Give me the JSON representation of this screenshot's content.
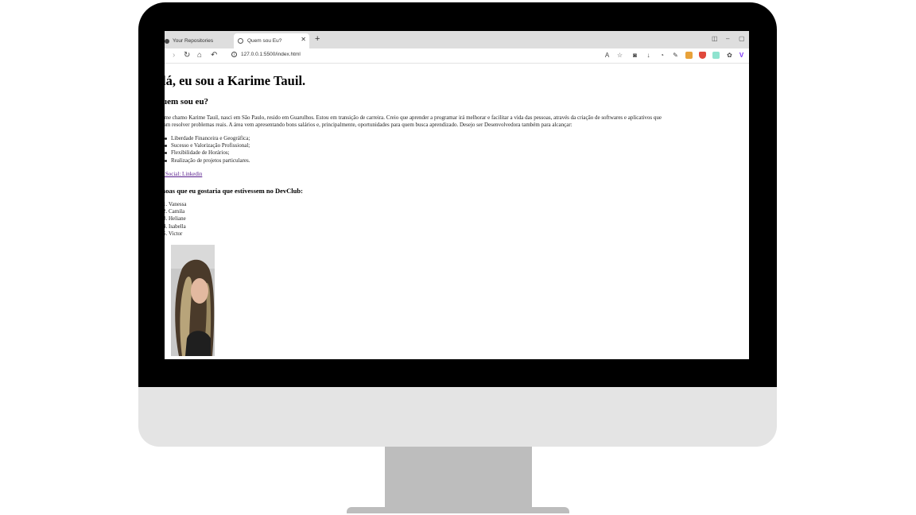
{
  "browser": {
    "tabs": [
      {
        "label": "Your Repositories",
        "active": false
      },
      {
        "label": "Quem sou Eu?",
        "active": true
      }
    ],
    "new_tab_icon": "plus-icon",
    "url": "127.0.0.1:5500/index.html",
    "toolbar_icons": [
      "translate-icon",
      "bookmark-star-icon",
      "screenshot-icon",
      "download-icon",
      "history-icon",
      "extension-icon",
      "extension-icon",
      "shield-icon",
      "extension-icon",
      "extension-icon",
      "vee-icon"
    ]
  },
  "page": {
    "h1": "lá, eu sou a Karime Tauil.",
    "h2": "uem sou eu?",
    "paragraph_line1": ", me chamo Karime Tauil, nasci em São Paulo, resido em Guarulhos. Estou em transição de carreira. Creio que aprender a programar irá melhorar e facilitar a vida das pessoas, através da criação de softwares e aplicativos que",
    "paragraph_line2": "sam resolver problemas reais. A área vem apresentando bons salários e, principalmente, oportunidades para quem busca aprendizado. Desejo ser Desenvolvedora também para alcançar:",
    "bullets": [
      "Liberdade Financeira e Geográfica;",
      "Sucesso e Valorização Profissional;",
      "Flexibilidade de Horários;",
      "Realização de projetos particulares."
    ],
    "link": "e Social: Linkedin",
    "h3": "soas que eu gostaria que estivessem no DevClub:",
    "people": [
      "1. Vanessa",
      "2. Camila",
      "3. Heliane",
      "4. Isabella",
      "5. Victor"
    ]
  }
}
